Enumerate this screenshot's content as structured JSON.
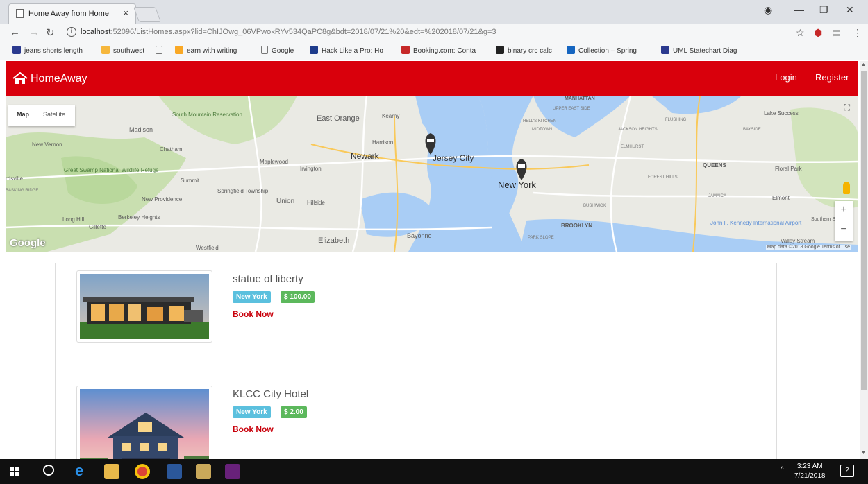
{
  "browser": {
    "tab_title": "Home Away from Home",
    "url_host": "localhost",
    "url_rest": ":52096/ListHomes.aspx?lid=ChIJOwg_06VPwokRYv534QaPC8g&bdt=2018/07/21%20&edt=%202018/07/21&g=3",
    "bookmarks": [
      "jeans shorts length",
      "southwest",
      "earn with writing",
      "Google",
      "Hack Like a Pro: Ho",
      "Booking.com: Conta",
      "binary crc calc",
      "Collection – Spring",
      "UML Statechart Diag"
    ],
    "bookmark_colors": [
      "#2b3a8f",
      "#f6b73c",
      "#888888",
      "#f9a825",
      "#43a047",
      "#1e3c8c",
      "#c62828",
      "#222222",
      "#1565c0"
    ]
  },
  "navbar": {
    "brand": "HomeAway",
    "login": "Login",
    "register": "Register",
    "color": "#d9000c"
  },
  "map": {
    "type_map": "Map",
    "type_satellite": "Satellite",
    "zoom_in": "+",
    "zoom_out": "−",
    "google": "Google",
    "attribution": "Map data ©2018 Google   Terms of Use",
    "place_labels": [
      "MANHATTAN",
      "UPPER EAST SIDE",
      "HELL'S KITCHEN",
      "MIDTOWN",
      "South Mountain Reservation",
      "East Orange",
      "Kearny",
      "Madison",
      "New Vernon",
      "Chatham",
      "Harrison",
      "Newark",
      "Jersey City",
      "New York",
      "Great Swamp National Wildlife Refuge",
      "Summit",
      "Maplewood",
      "Irvington",
      "Springfield Township",
      "Union",
      "Hillside",
      "New Providence",
      "Long Hill",
      "Berkeley Heights",
      "Gillette",
      "Westfield",
      "Elizabeth",
      "Bayonne",
      "BROOKLYN",
      "PARK SLOPE",
      "BUSHWICK",
      "JACKSON HEIGHTS",
      "ELMHURST",
      "FOREST HILLS",
      "QUEENS",
      "FLUSHING",
      "BAYSIDE",
      "Lake Success",
      "Floral Park",
      "Elmont",
      "JAMAICA",
      "John F. Kennedy International Airport",
      "Valley Stream",
      "Southern St",
      "rdsville",
      "BASKING RIDGE"
    ]
  },
  "listings": [
    {
      "name": "statue of liberty",
      "city": "New York",
      "price": "$ 100.00",
      "action": "Book Now"
    },
    {
      "name": "KLCC City Hotel",
      "city": "New York",
      "price": "$ 2.00",
      "action": "Book Now"
    }
  ],
  "taskbar": {
    "time": "3:23 AM",
    "date": "7/21/2018",
    "notifications": "2"
  }
}
